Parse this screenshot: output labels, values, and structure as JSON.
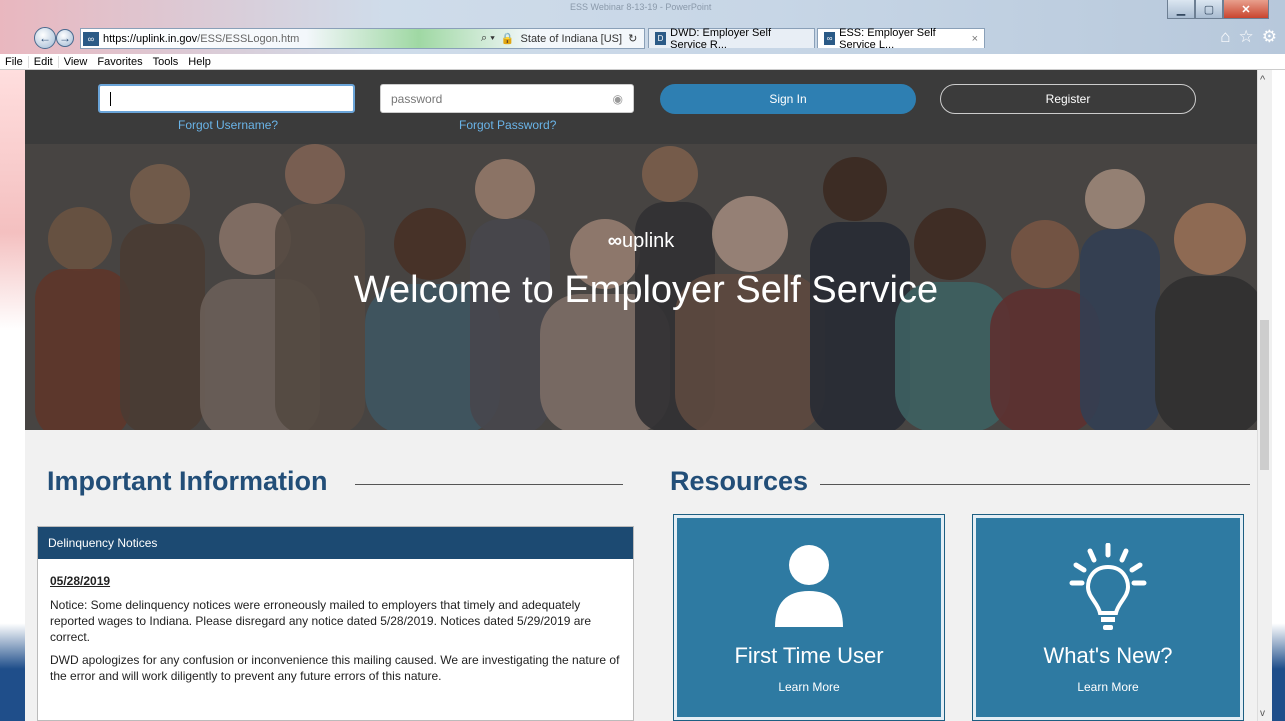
{
  "browser": {
    "window_title": "ESS Webinar 8-13-19 - PowerPoint",
    "url_host": "https://uplink.in.gov",
    "url_path": "/ESS/ESSLogon.htm",
    "site_identity": "State of Indiana [US]",
    "tabs": [
      {
        "label": "DWD: Employer Self Service R...",
        "active": false
      },
      {
        "label": "ESS: Employer Self Service L...",
        "active": true
      }
    ],
    "menu": [
      "File",
      "Edit",
      "View",
      "Favorites",
      "Tools",
      "Help"
    ]
  },
  "login": {
    "username_value": "",
    "password_placeholder": "password",
    "forgot_username": "Forgot Username?",
    "forgot_password": "Forgot Password?",
    "sign_in": "Sign In",
    "register": "Register"
  },
  "hero": {
    "logo_text": "uplink",
    "title": "Welcome to Employer Self Service"
  },
  "important": {
    "title": "Important Information",
    "card_header": "Delinquency Notices",
    "date": "05/28/2019",
    "paragraph1": "Notice: Some delinquency notices were erroneously mailed to employers that timely and adequately reported wages to Indiana. Please disregard any notice dated 5/28/2019. Notices dated 5/29/2019 are correct.",
    "paragraph2": "DWD apologizes for any confusion or inconvenience this mailing caused. We are investigating the nature of the error and will work diligently to prevent any future errors of this nature."
  },
  "resources": {
    "title": "Resources",
    "cards": [
      {
        "title": "First Time User",
        "link": "Learn More",
        "icon": "user-icon"
      },
      {
        "title": "What's New?",
        "link": "Learn More",
        "icon": "lightbulb-icon"
      }
    ]
  },
  "colors": {
    "login_bar": "#3b3b3b",
    "primary_blue": "#2e7fb2",
    "heading_blue": "#224e78",
    "card_header": "#1c4a72",
    "resource_card": "#2e7aa2"
  }
}
